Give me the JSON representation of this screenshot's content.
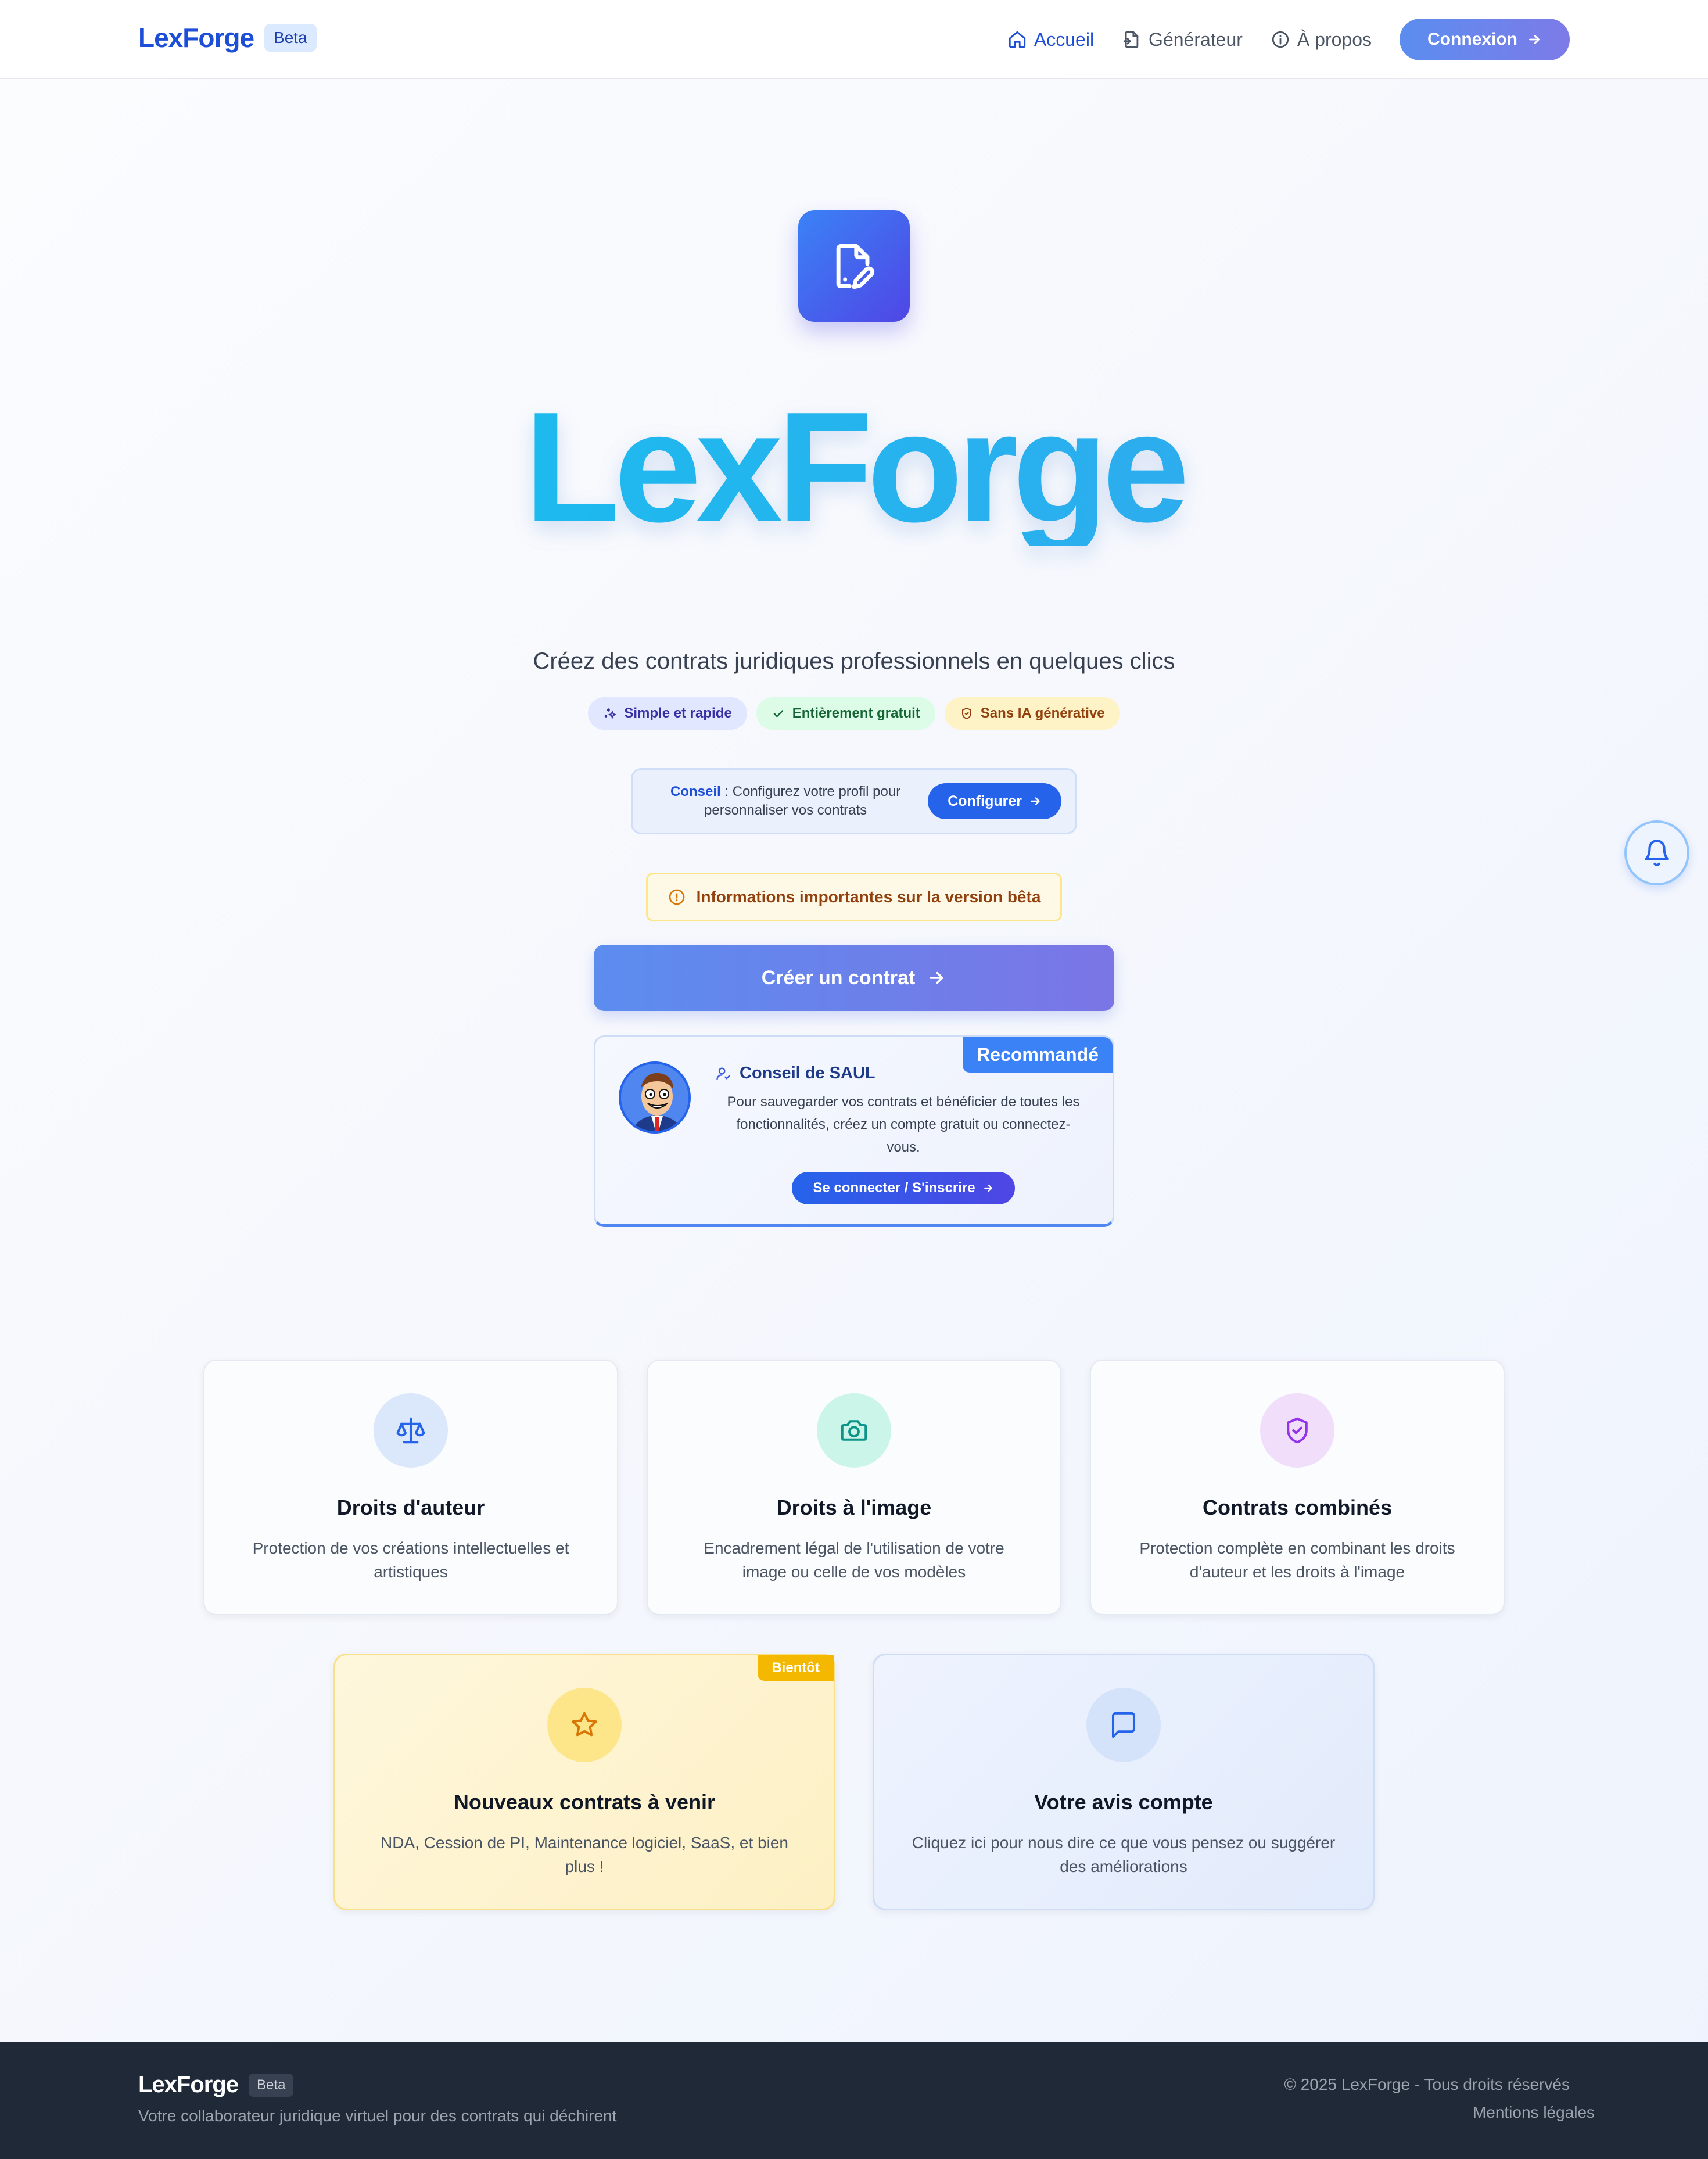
{
  "nav": {
    "brand": "LexForge",
    "beta": "Beta",
    "links": [
      {
        "label": "Accueil",
        "icon": "home-icon",
        "active": true
      },
      {
        "label": "Générateur",
        "icon": "file-icon",
        "active": false
      },
      {
        "label": "À propos",
        "icon": "info-icon",
        "active": false
      }
    ],
    "login": "Connexion"
  },
  "hero": {
    "icon": "document-edit-icon",
    "title": "LexForge",
    "subtitle": "Créez des contrats juridiques professionnels en quelques clics",
    "badges": [
      {
        "label": "Simple et rapide",
        "icon": "sparkles-icon"
      },
      {
        "label": "Entièrement gratuit",
        "icon": "check-icon"
      },
      {
        "label": "Sans IA générative",
        "icon": "shield-icon"
      }
    ]
  },
  "tip": {
    "strong": "Conseil",
    "text": " : Configurez votre profil pour personnaliser vos contrats",
    "button": "Configurer"
  },
  "warning": "Informations importantes sur la version bêta",
  "cta": "Créer un contrat",
  "saul": {
    "badge": "Recommandé",
    "title": "Conseil de SAUL",
    "text": "Pour sauvegarder vos contrats et bénéficier de toutes les fonctionnalités, créez un compte gratuit ou connectez-vous.",
    "button": "Se connecter / S'inscrire"
  },
  "features": [
    {
      "title": "Droits d'auteur",
      "desc": "Protection de vos créations intellectuelles et artistiques",
      "icon": "scale-icon"
    },
    {
      "title": "Droits à l'image",
      "desc": "Encadrement légal de l'utilisation de votre image ou celle de vos modèles",
      "icon": "camera-icon"
    },
    {
      "title": "Contrats combinés",
      "desc": "Protection complète en combinant les droits d'auteur et les droits à l'image",
      "icon": "shield-check-icon"
    },
    {
      "title": "Nouveaux contrats à venir",
      "desc": "NDA, Cession de PI, Maintenance logiciel, SaaS, et bien plus !",
      "icon": "star-icon",
      "badge": "Bientôt"
    },
    {
      "title": "Votre avis compte",
      "desc": "Cliquez ici pour nous dire ce que vous pensez ou suggérer des améliorations",
      "icon": "message-icon"
    }
  ],
  "footer": {
    "brand": "LexForge",
    "beta": "Beta",
    "tagline": "Votre collaborateur juridique virtuel pour des contrats qui déchirent",
    "copyright": "© 2025 LexForge - Tous droits réservés",
    "legal": "Mentions légales"
  },
  "colors": {
    "primary": "#2563eb",
    "brand": "#1d4ed8",
    "title_gradient_start": "#10c4ee",
    "title_gradient_end": "#3aa3ee",
    "footer_bg": "#1f2937"
  }
}
